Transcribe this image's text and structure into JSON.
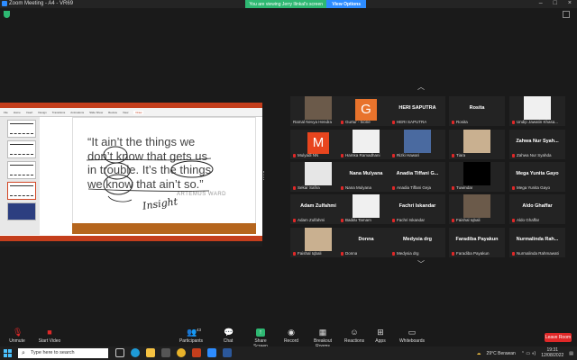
{
  "window": {
    "title": "Zoom Meeting - A4 - VR69"
  },
  "share_banner": {
    "message": "You are viewing Jerry Ilinkal's screen",
    "view_options": "View Options"
  },
  "slide": {
    "quote_lines": [
      "“It ain’t the things we",
      "don’t know that gets us",
      "in trouble. It’s the things",
      "we know that ain’t so.”"
    ],
    "author": "ARTEMUS WARD",
    "handwriting": "Insight"
  },
  "gallery": {
    "tiles": [
      {
        "display": "",
        "label": "Ramal Nevya Hendra",
        "muted": false,
        "kind": "video"
      },
      {
        "display": "G",
        "label": "Gurtur - tvone",
        "muted": true,
        "kind": "letter",
        "color": "#e8732c"
      },
      {
        "display": "HERI SAPUTRA",
        "label": "HERI SAPUTRA",
        "muted": true,
        "kind": "name"
      },
      {
        "display": "Rosita",
        "label": "Rosita",
        "muted": true,
        "kind": "name"
      },
      {
        "display": "",
        "label": "Undip Jawatin Khasa...",
        "muted": true,
        "kind": "logo"
      },
      {
        "display": "M",
        "label": "Mulyadi NN",
        "muted": true,
        "kind": "letter",
        "color": "#e8451e"
      },
      {
        "display": "",
        "label": "Hamka Ramadhani",
        "muted": true,
        "kind": "logo"
      },
      {
        "display": "",
        "label": "Rizki Hawari",
        "muted": true,
        "kind": "video"
      },
      {
        "display": "",
        "label": "Tiara",
        "muted": true,
        "kind": "video"
      },
      {
        "display": "Zahwa Nur Syah...",
        "label": "Zahwa Nur Syahda",
        "muted": true,
        "kind": "name"
      },
      {
        "display": "",
        "label": "Sekar Safira",
        "muted": true,
        "kind": "video"
      },
      {
        "display": "Nana Mulyana",
        "label": "Nana Mulyana",
        "muted": true,
        "kind": "name"
      },
      {
        "display": "Anadia Tiffani G...",
        "label": "Anadia Tiffani Geja",
        "muted": true,
        "kind": "name"
      },
      {
        "display": "",
        "label": "Tuwindar",
        "muted": true,
        "kind": "black"
      },
      {
        "display": "Mega Yunita Gayo",
        "label": "Mega Yunita Gayo",
        "muted": true,
        "kind": "name"
      },
      {
        "display": "Adam Zulfahmi",
        "label": "Adam Zulfahmi",
        "muted": true,
        "kind": "name"
      },
      {
        "display": "",
        "label": "Baddu Tamam",
        "muted": true,
        "kind": "logo"
      },
      {
        "display": "Fachri Iskandar",
        "label": "Fachri Iskandar",
        "muted": true,
        "kind": "name"
      },
      {
        "display": "",
        "label": "Faishal Iqbali",
        "muted": true,
        "kind": "video"
      },
      {
        "display": "Aldo Ghaffar",
        "label": "Aldo Ghaffar",
        "muted": true,
        "kind": "name"
      },
      {
        "display": "",
        "label": "Faishal Iqbali",
        "muted": true,
        "kind": "video"
      },
      {
        "display": "Donna",
        "label": "Donna",
        "muted": true,
        "kind": "name"
      },
      {
        "display": "Medysia drg",
        "label": "Medysia drg",
        "muted": true,
        "kind": "name"
      },
      {
        "display": "Faradiba Payakun",
        "label": "Faradiba Payakun",
        "muted": true,
        "kind": "name"
      },
      {
        "display": "Nurmalinda Rah...",
        "label": "Nurmalinda Rahmawati",
        "muted": true,
        "kind": "name"
      }
    ]
  },
  "toolbar": {
    "unmute": "Unmute",
    "start_video": "Start Video",
    "participants": "Participants",
    "participants_count": "43",
    "chat": "Chat",
    "share_screen": "Share Screen",
    "record": "Record",
    "breakout": "Breakout Rooms",
    "reactions": "Reactions",
    "apps": "Apps",
    "whiteboards": "Whiteboards",
    "leave": "Leave Room"
  },
  "taskbar": {
    "search_placeholder": "Type here to search",
    "weather": "29°C Berawan",
    "time": "19:31",
    "date": "12/08/2022"
  }
}
